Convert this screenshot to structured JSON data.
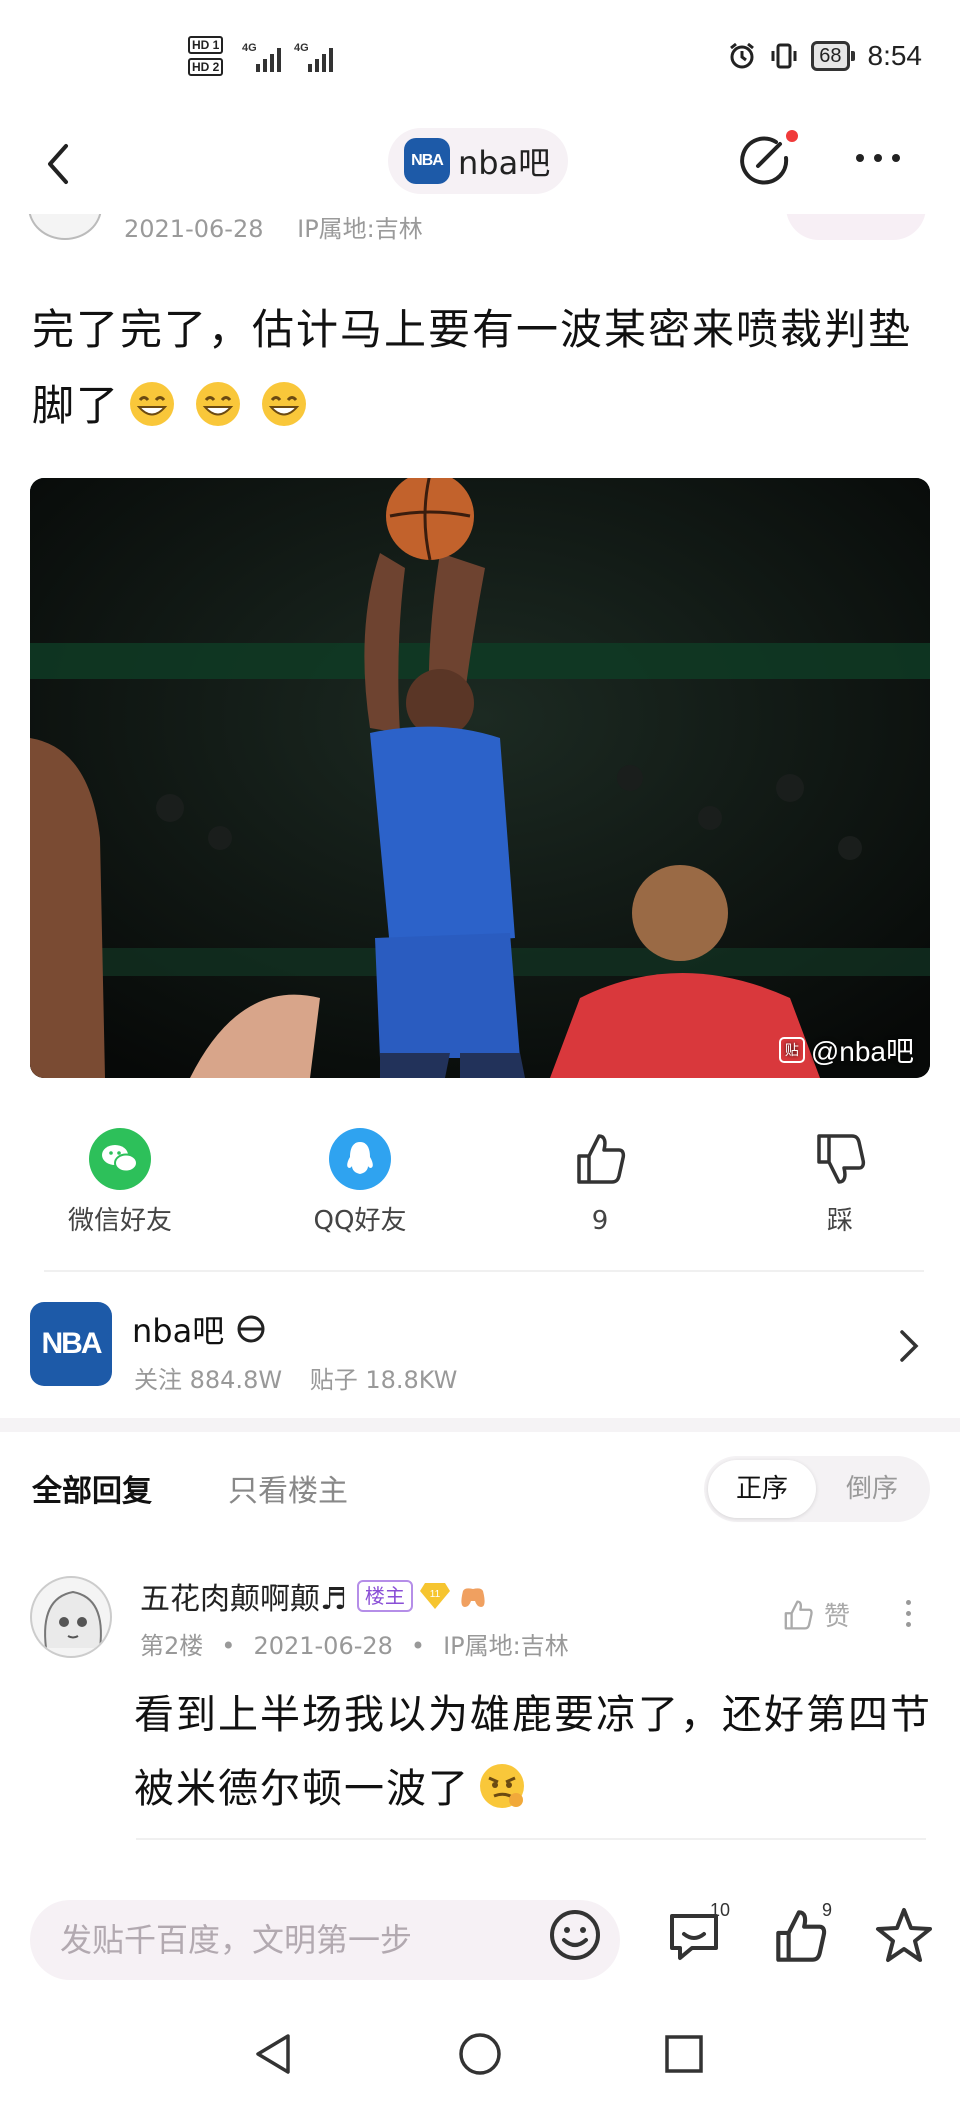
{
  "status_bar": {
    "sim1_label": "HD 1",
    "sim2_label": "HD 2",
    "network1": "4G",
    "network2": "4G",
    "battery": "68",
    "time": "8:54"
  },
  "nav": {
    "forum_logo_text": "NBA",
    "forum_name": "nba吧"
  },
  "post": {
    "date": "2021-06-28",
    "ip_location": "IP属地:吉林",
    "text": "完了完了，估计马上要有一波某密来喷裁判垫脚了",
    "image_watermark": "@nba吧",
    "image_watermark_badge": "贴"
  },
  "actions": {
    "wechat_label": "微信好友",
    "qq_label": "QQ好友",
    "like_count": "9",
    "dislike_label": "踩"
  },
  "forum_card": {
    "logo_text": "NBA",
    "name": "nba吧",
    "followers": "关注 884.8W",
    "posts": "贴子 18.8KW"
  },
  "reply_tabs": {
    "all_label": "全部回复",
    "owner_only_label": "只看楼主",
    "sort_asc": "正序",
    "sort_desc": "倒序"
  },
  "reply": {
    "username": "五花肉颠啊颠♬",
    "owner_badge": "楼主",
    "level": "11",
    "floor": "第2楼",
    "date": "2021-06-28",
    "ip_location": "IP属地:吉林",
    "like_label": "赞",
    "text": "看到上半场我以为雄鹿要凉了，还好第四节被米德尔顿一波了"
  },
  "input_bar": {
    "placeholder": "发贴千百度，文明第一步",
    "comment_count": "10",
    "like_count": "9"
  },
  "colors": {
    "nba_blue": "#1d5aa8",
    "wechat_green": "#2dc05a",
    "qq_blue": "#2fa3f0",
    "notification_red": "#f03a3a",
    "owner_badge_purple": "#8a4fd6"
  }
}
